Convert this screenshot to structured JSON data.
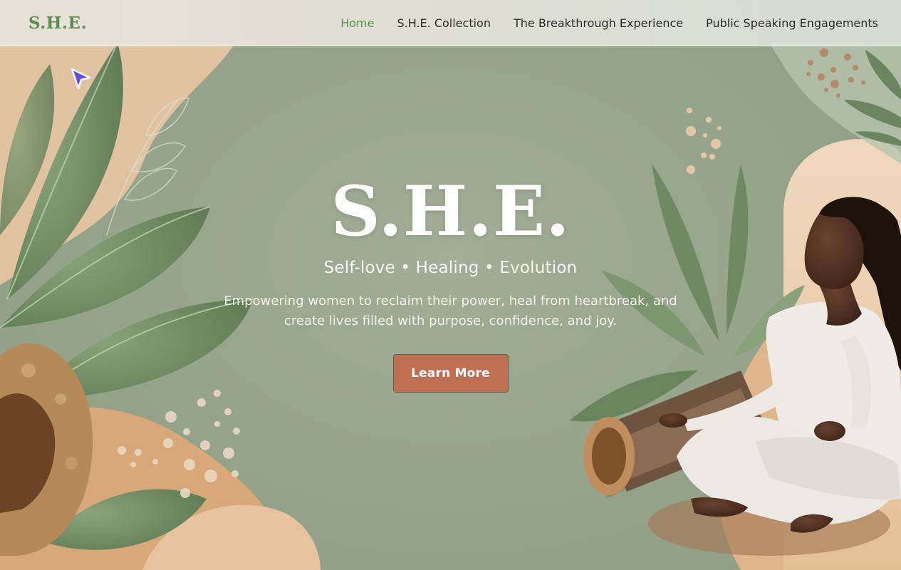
{
  "header": {
    "logo": "S.H.E.",
    "nav": [
      {
        "label": "Home",
        "active": true
      },
      {
        "label": "S.H.E. Collection",
        "active": false
      },
      {
        "label": "The Breakthrough Experience",
        "active": false
      },
      {
        "label": "Public Speaking Engagements",
        "active": false
      }
    ]
  },
  "hero": {
    "title": "S.H.E.",
    "tagline": "Self-love • Healing • Evolution",
    "description": "Empowering women to reclaim their power, heal from heartbreak, and create lives filled with purpose, confidence, and joy.",
    "cta_label": "Learn More"
  },
  "icons": {
    "cursor": "mouse-pointer-icon",
    "background": [
      "sage-leaf-icon",
      "sponge-texture-icon",
      "meditating-woman-illustration",
      "wood-log-icon"
    ]
  },
  "colors": {
    "brand_green": "#5f8c56",
    "background_sage": "#93a288",
    "cta": "#c06f55",
    "nav_text": "#2c2c2a"
  }
}
